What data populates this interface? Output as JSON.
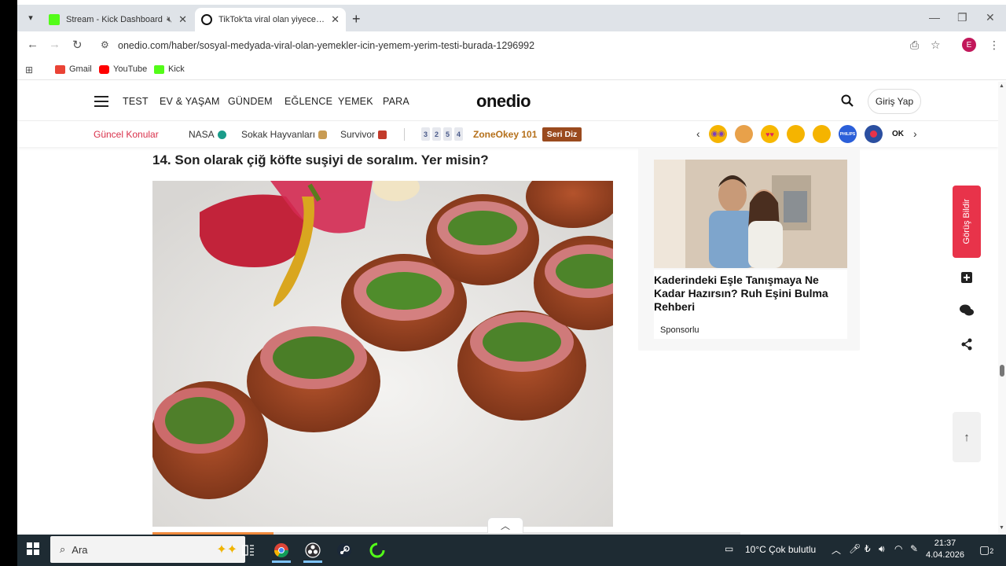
{
  "browser": {
    "tabs": [
      {
        "title": "Stream - Kick Dashboard",
        "active": false,
        "favicon_color": "#53fc18"
      },
      {
        "title": "TikTok'ta viral olan yiyecekler n",
        "active": true,
        "favicon_color": "#111111"
      }
    ],
    "url": "onedio.com/haber/sosyal-medyada-viral-olan-yemekler-icin-yemem-yerim-testi-burada-1296992",
    "profile_initial": "E",
    "bookmarks": [
      {
        "label": "Gmail",
        "color": "#ea4335"
      },
      {
        "label": "YouTube",
        "color": "#ff0000"
      },
      {
        "label": "Kick",
        "color": "#53fc18"
      }
    ]
  },
  "site": {
    "nav": [
      "TEST",
      "EV & YAŞAM",
      "GÜNDEM",
      "EĞLENCE",
      "YEMEK",
      "PARA"
    ],
    "logo": "onedio",
    "login": "Giriş Yap",
    "topics_title": "Güncel Konular",
    "topics": [
      {
        "label": "NASA"
      },
      {
        "label": "Sokak Hayvanları"
      },
      {
        "label": "Survivor"
      }
    ],
    "number_tiles": [
      "3",
      "2",
      "5",
      "4"
    ],
    "zoneokey": "ZoneOkey 101",
    "seridiz": "Seri Diz",
    "emojis": [
      {
        "name": "party-emoji",
        "color": "#f5b400"
      },
      {
        "name": "hug-emoji",
        "color": "#e8a14a"
      },
      {
        "name": "heart-eyes-emoji",
        "color": "#f7b800"
      },
      {
        "name": "sad-emoji",
        "color": "#f5b400"
      },
      {
        "name": "happy-emoji",
        "color": "#f5b400"
      },
      {
        "name": "philips-logo",
        "color": "#2b5fd9"
      },
      {
        "name": "onedio-brand",
        "color": "#2b4fa0"
      },
      {
        "name": "ok-brand",
        "color": "#ffffff"
      }
    ],
    "philips_label": "PHILIPS",
    "ok_label": "OK"
  },
  "article": {
    "heading": "14. Son olarak çiğ köfte suşiyi de soralım. Yer misin?"
  },
  "ad": {
    "title": "Kaderindeki Eşle Tanışmaya Ne Kadar Hazırsın? Ruh Eşini Bulma Rehberi",
    "sponsor": "Sponsorlu"
  },
  "rail": {
    "feedback": "Görüş Bildir"
  },
  "taskbar": {
    "search_placeholder": "Ara",
    "weather": "10°C  Çok bulutlu",
    "time": "21:37",
    "date": "4.04.2026",
    "notifications": "2"
  },
  "colors": {
    "accent_red": "#e8334a",
    "topic_title": "#d9304a",
    "seri_diz": "#9a4a1e"
  }
}
